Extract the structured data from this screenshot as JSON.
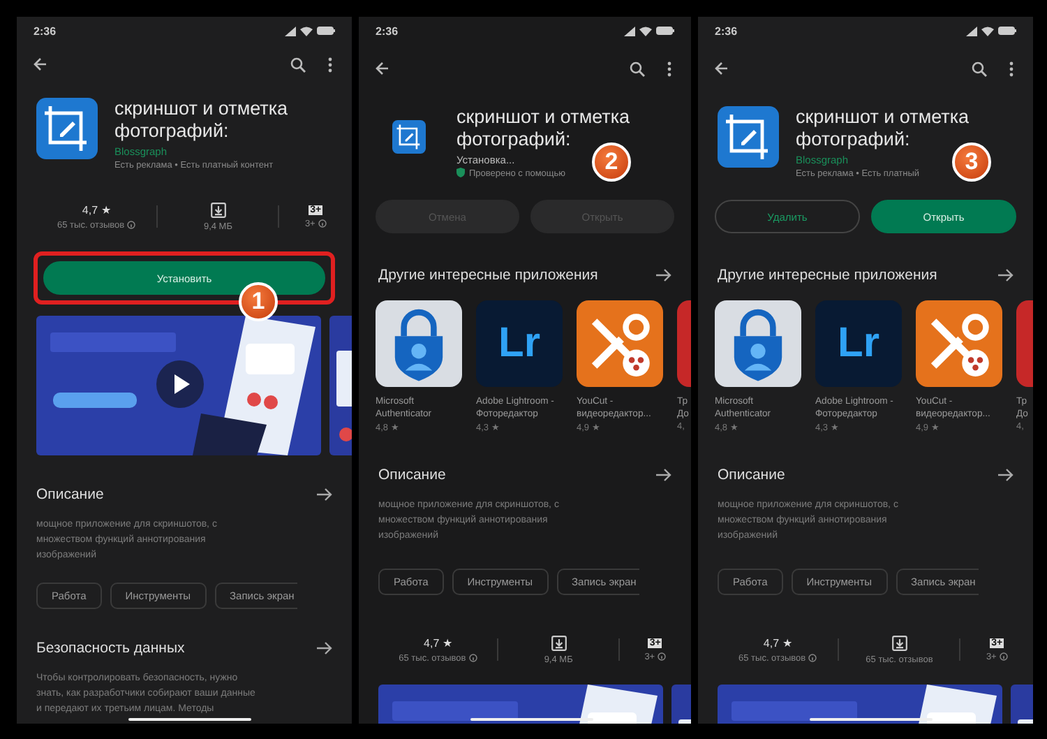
{
  "panels": [
    {
      "badge": "1",
      "time": "2:36",
      "sections": [
        {
          "kind": "header",
          "title": "скриншот и отметка фотографий:",
          "installing": false,
          "developer": "Blossgraph",
          "meta": "Есть реклама • Есть платный контент"
        },
        {
          "kind": "stats",
          "rating": "4,7 ★",
          "reviews": "65 тыс. отзывов",
          "size": "9,4 МБ",
          "age": "3+",
          "age_note": "3+"
        },
        {
          "kind": "buttons",
          "highlighted": true,
          "items": [
            {
              "kind": "filled",
              "label": "Установить",
              "disabled": false
            }
          ]
        },
        {
          "kind": "carousel",
          "video": true
        },
        {
          "kind": "section",
          "title": "Описание"
        },
        {
          "kind": "text",
          "text": "мощное приложение для скриншотов, с множеством функций аннотирования изображений"
        },
        {
          "kind": "chips",
          "items": [
            "Работа",
            "Инструменты",
            "Запись экран"
          ]
        },
        {
          "kind": "section",
          "title": "Безопасность данных"
        },
        {
          "kind": "text",
          "text": "Чтобы контролировать безопасность, нужно знать, как разработчики собирают ваши данные и передают их третьим лицам. Методы"
        }
      ]
    },
    {
      "badge": "2",
      "time": "2:36",
      "sections": [
        {
          "kind": "header",
          "title": "скриншот и отметка фотографий:",
          "installing": true,
          "status": "Установка...",
          "verified": "Проверено с помощью"
        },
        {
          "kind": "buttons",
          "items": [
            {
              "kind": "outline",
              "label": "Отмена",
              "disabled": true
            },
            {
              "kind": "filled",
              "label": "Открыть",
              "disabled": true
            }
          ]
        },
        {
          "kind": "section",
          "title": "Другие интересные приложения"
        },
        {
          "kind": "apps",
          "items": [
            {
              "kind": "lock",
              "name": "Microsoft Authenticator",
              "rating": "4,8 ★"
            },
            {
              "kind": "logo",
              "icon_text": "Lr",
              "name": "Adobe Lightroom - Фоторедактор",
              "rating": "4,3 ★"
            },
            {
              "kind": "scissors",
              "name": "YouCut - видеоредактор...",
              "rating": "4,9 ★"
            },
            {
              "kind": "plain",
              "name": "Тр До",
              "rating": "4,"
            }
          ]
        },
        {
          "kind": "section",
          "title": "Описание"
        },
        {
          "kind": "text",
          "text": "мощное приложение для скриншотов, с множеством функций аннотирования изображений"
        },
        {
          "kind": "chips",
          "items": [
            "Работа",
            "Инструменты",
            "Запись экран"
          ]
        },
        {
          "kind": "stats",
          "rating": "4,7 ★",
          "reviews": "65 тыс. отзывов",
          "size": "9,4 МБ",
          "age": "3+",
          "age_note": "3+"
        },
        {
          "kind": "carousel"
        }
      ]
    },
    {
      "badge": "3",
      "time": "2:36",
      "sections": [
        {
          "kind": "header",
          "title": "скриншот и отметка фотографий:",
          "installing": false,
          "developer": "Blossgraph",
          "meta": "Есть реклама • Есть платный"
        },
        {
          "kind": "buttons",
          "items": [
            {
              "kind": "outline",
              "label": "Удалить",
              "disabled": false
            },
            {
              "kind": "filled",
              "label": "Открыть",
              "disabled": false
            }
          ]
        },
        {
          "kind": "section",
          "title": "Другие интересные приложения"
        },
        {
          "kind": "apps",
          "items": [
            {
              "kind": "lock",
              "name": "Microsoft Authenticator",
              "rating": "4,8 ★"
            },
            {
              "kind": "logo",
              "icon_text": "Lr",
              "name": "Adobe Lightroom - Фоторедактор",
              "rating": "4,3 ★"
            },
            {
              "kind": "scissors",
              "name": "YouCut - видеоредактор...",
              "rating": "4,9 ★"
            },
            {
              "kind": "plain",
              "name": "Тр До",
              "rating": "4,"
            }
          ]
        },
        {
          "kind": "section",
          "title": "Описание"
        },
        {
          "kind": "text",
          "text": "мощное приложение для скриншотов, с множеством функций аннотирования изображений"
        },
        {
          "kind": "chips",
          "items": [
            "Работа",
            "Инструменты",
            "Запись экран"
          ]
        },
        {
          "kind": "stats",
          "rating": "4,7 ★",
          "reviews": "65 тыс. отзывов",
          "size": "65 тыс. отзывов",
          "age": "3+",
          "age_note": "3+"
        },
        {
          "kind": "carousel"
        }
      ]
    }
  ]
}
